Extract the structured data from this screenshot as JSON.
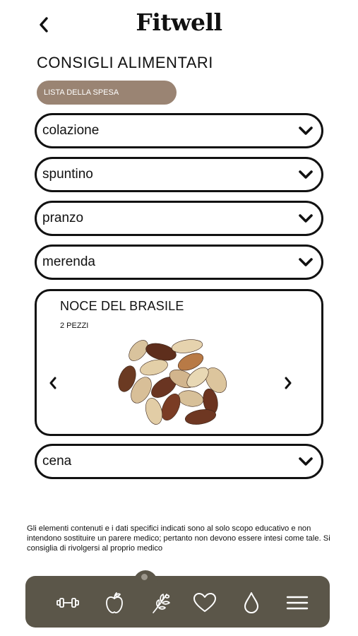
{
  "header": {
    "logo": "Fitwell"
  },
  "page": {
    "title": "CONSIGLI ALIMENTARI",
    "shopping_list_label": "LISTA DELLA SPESA"
  },
  "meals": [
    {
      "label": "colazione"
    },
    {
      "label": "spuntino"
    },
    {
      "label": "pranzo"
    },
    {
      "label": "merenda"
    },
    {
      "label": "cena"
    }
  ],
  "food_card": {
    "title": "NOCE DEL BRASILE",
    "quantity": "2 PEZZI",
    "image": "brazil-nuts"
  },
  "disclaimer": "Gli elementi contenuti e i dati specifici indicati sono al solo scopo educativo e non intendono sostituire un parere medico; pertanto non devono essere intesi come tale. Si consiglia di rivolgersi al proprio medico",
  "nav": {
    "items": [
      "dumbbell-icon",
      "apple-icon",
      "leaf-icon",
      "heart-icon",
      "drop-icon",
      "menu-icon"
    ],
    "active_index": 1
  },
  "colors": {
    "chip": "#9a8473",
    "navbar": "#5b5649",
    "text": "#111111"
  }
}
